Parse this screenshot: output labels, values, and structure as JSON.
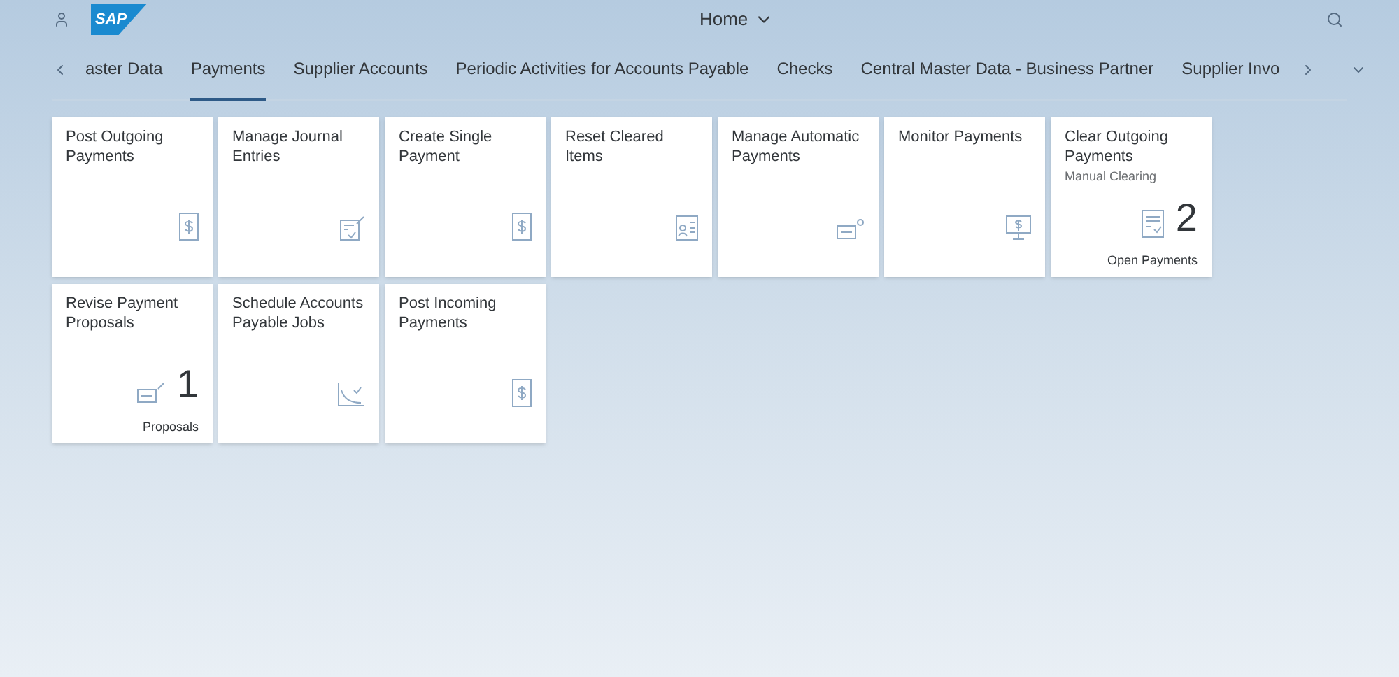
{
  "header": {
    "logo": "SAP",
    "title": "Home"
  },
  "tabs": [
    {
      "label": "aster Data",
      "selected": false
    },
    {
      "label": "Payments",
      "selected": true
    },
    {
      "label": "Supplier Accounts",
      "selected": false
    },
    {
      "label": "Periodic Activities for Accounts Payable",
      "selected": false
    },
    {
      "label": "Checks",
      "selected": false
    },
    {
      "label": "Central Master Data - Business Partner",
      "selected": false
    },
    {
      "label": "Supplier Invo",
      "selected": false
    }
  ],
  "tiles": [
    {
      "title": "Post Outgoing Payments"
    },
    {
      "title": "Manage Journal Entries"
    },
    {
      "title": "Create Single Payment"
    },
    {
      "title": "Reset Cleared Items"
    },
    {
      "title": "Manage Automatic Payments"
    },
    {
      "title": "Monitor Payments"
    },
    {
      "title": "Clear Outgoing Payments",
      "subtitle": "Manual Clearing",
      "number": "2",
      "footer": "Open Payments"
    },
    {
      "title": "Revise Payment Proposals",
      "number": "1",
      "footer": "Proposals"
    },
    {
      "title": "Schedule Accounts Payable Jobs"
    },
    {
      "title": "Post Incoming Payments"
    }
  ]
}
